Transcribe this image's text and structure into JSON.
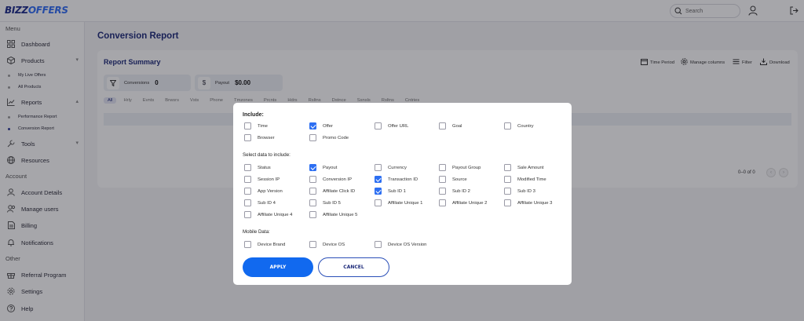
{
  "brand": {
    "logo_part1": "BIZZ",
    "logo_part2": "OFFERS"
  },
  "header": {
    "search_placeholder": "Search"
  },
  "sidebar": {
    "menu_heading": "Menu",
    "account_heading": "Account",
    "other_heading": "Other",
    "items": {
      "dashboard": "Dashboard",
      "products": "Products",
      "my_live_offers": "My Live Offers",
      "all_products": "All Products",
      "reports": "Reports",
      "performance_report": "Performance Report",
      "conversion_report": "Conversion Report",
      "tools": "Tools",
      "resources": "Resources",
      "account_details": "Account Details",
      "manage_users": "Manage users",
      "billing": "Billing",
      "notifications": "Notifications",
      "referral_program": "Referral Program",
      "settings": "Settings",
      "help": "Help"
    }
  },
  "page": {
    "title": "Conversion Report",
    "card_title": "Report Summary",
    "toolbar": {
      "time_period": "Time Period",
      "manage_columns": "Manage columns",
      "filter": "Filter",
      "download": "Download"
    },
    "stats": {
      "conversions_label": "Conversions",
      "conversions_value": "0",
      "payout_label": "Payout",
      "payout_value": "$0.00"
    },
    "tabs": [
      "All",
      "Hrly",
      "Evnts",
      "Brwsrs",
      "Vsts",
      "Phone",
      "Tmzones",
      "Prcnts",
      "Hdrs",
      "Rsltns",
      "Dstnce",
      "Ssnsls",
      "Rsltns",
      "Cntries"
    ],
    "pagination": "0–0 of 0"
  },
  "modal": {
    "include_heading": "Include:",
    "select_heading": "Select data to include:",
    "mobile_heading": "Mobile Data:",
    "apply_label": "Apply",
    "cancel_label": "Cancel",
    "include_options": [
      {
        "label": "Time",
        "checked": false
      },
      {
        "label": "Offer",
        "checked": true
      },
      {
        "label": "Offer URL",
        "checked": false
      },
      {
        "label": "Goal",
        "checked": false
      },
      {
        "label": "Country",
        "checked": false
      },
      {
        "label": "Browser",
        "checked": false
      },
      {
        "label": "Promo Code",
        "checked": false
      }
    ],
    "data_options": [
      {
        "label": "Status",
        "checked": false
      },
      {
        "label": "Payout",
        "checked": true
      },
      {
        "label": "Currency",
        "checked": false
      },
      {
        "label": "Payout Group",
        "checked": false
      },
      {
        "label": "Sale Amount",
        "checked": false
      },
      {
        "label": "Session IP",
        "checked": false
      },
      {
        "label": "Conversion IP",
        "checked": false
      },
      {
        "label": "Transaction ID",
        "checked": true
      },
      {
        "label": "Source",
        "checked": false
      },
      {
        "label": "Modified Time",
        "checked": false
      },
      {
        "label": "App Version",
        "checked": false
      },
      {
        "label": "Affiliate Click ID",
        "checked": false
      },
      {
        "label": "Sub ID 1",
        "checked": true
      },
      {
        "label": "Sub ID 2",
        "checked": false
      },
      {
        "label": "Sub ID 3",
        "checked": false
      },
      {
        "label": "Sub ID 4",
        "checked": false
      },
      {
        "label": "Sub ID 5",
        "checked": false
      },
      {
        "label": "Affiliate Unique 1",
        "checked": false
      },
      {
        "label": "Affiliate Unique 2",
        "checked": false
      },
      {
        "label": "Affiliate Unique 3",
        "checked": false
      },
      {
        "label": "Affiliate Unique 4",
        "checked": false
      },
      {
        "label": "Affiliate Unique 5",
        "checked": false
      }
    ],
    "mobile_options": [
      {
        "label": "Device Brand",
        "checked": false
      },
      {
        "label": "Device OS",
        "checked": false
      },
      {
        "label": "Device OS Version",
        "checked": false
      }
    ]
  },
  "colors": {
    "accent": "#1169ef",
    "brand_dark": "#1e2b7a",
    "checkbox_on": "#2d6ff2"
  }
}
